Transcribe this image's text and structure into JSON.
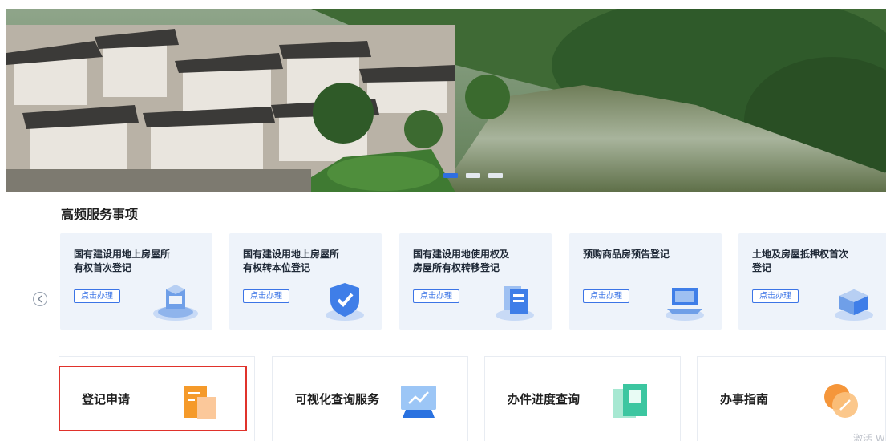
{
  "banner": {
    "slide_count": 3,
    "active_slide": 1
  },
  "section_title": "高频服务事项",
  "carousel": {
    "prev_icon": "chevron-left-icon"
  },
  "services": [
    {
      "line1": "国有建设用地上房屋所",
      "line2": "有权首次登记",
      "button": "点击办理",
      "icon": "server-box-icon"
    },
    {
      "line1": "国有建设用地上房屋所",
      "line2": "有权转本位登记",
      "button": "点击办理",
      "icon": "shield-check-icon"
    },
    {
      "line1": "国有建设用地使用权及",
      "line2": "房屋所有权转移登记",
      "button": "点击办理",
      "icon": "document-stack-icon"
    },
    {
      "line1": "预购商品房预告登记",
      "line2": "",
      "button": "点击办理",
      "icon": "laptop-icon"
    },
    {
      "line1": "土地及房屋抵押权首次",
      "line2": "登记",
      "button": "点击办理",
      "icon": "cube-stack-icon"
    }
  ],
  "quick_links": [
    {
      "label": "登记申请",
      "icon": "document-orange-icon",
      "color": "#f59a2a"
    },
    {
      "label": "可视化查询服务",
      "icon": "monitor-chart-icon",
      "color": "#3a8ef0"
    },
    {
      "label": "办件进度查询",
      "icon": "clipboard-green-icon",
      "color": "#3cc6a0"
    },
    {
      "label": "办事指南",
      "icon": "compass-orange-icon",
      "color": "#f5963a"
    }
  ],
  "watermark": "激活 W"
}
